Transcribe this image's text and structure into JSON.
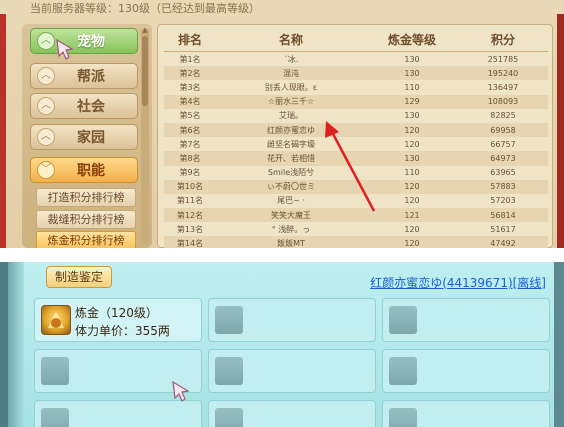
{
  "ranking": {
    "server_info": "当前服务器等级：130级（已经达到最高等级）",
    "nav": [
      {
        "label": "宠物",
        "state": "active",
        "chevron": "up"
      },
      {
        "label": "帮派",
        "state": "normal",
        "chevron": "up"
      },
      {
        "label": "社会",
        "state": "normal",
        "chevron": "up"
      },
      {
        "label": "家园",
        "state": "normal",
        "chevron": "up"
      },
      {
        "label": "职能",
        "state": "open",
        "chevron": "down"
      }
    ],
    "sub_nav": [
      {
        "label": "打造积分排行榜",
        "selected": false
      },
      {
        "label": "裁缝积分排行榜",
        "selected": false
      },
      {
        "label": "炼金积分排行榜",
        "selected": true
      }
    ],
    "columns": [
      "排名",
      "名称",
      "炼金等级",
      "积分"
    ],
    "rows": [
      [
        "第1名",
        "ˊ冰.",
        "130",
        "251785"
      ],
      [
        "第2名",
        "混沌",
        "130",
        "195240"
      ],
      [
        "第3名",
        "别丢人现眼。ε",
        "110",
        "136497"
      ],
      [
        "第4名",
        "☆丽水三千☆",
        "129",
        "108093"
      ],
      [
        "第5名",
        "艾瑞。",
        "130",
        "82825"
      ],
      [
        "第6名",
        "红颜亦蜜恋ゆ",
        "120",
        "69958"
      ],
      [
        "第7名",
        "雌坚名碣字壕",
        "120",
        "66757"
      ],
      [
        "第8名",
        "花开、若相惜",
        "130",
        "64973"
      ],
      [
        "第9名",
        "Smile浅陌兮",
        "110",
        "63965"
      ],
      [
        "第10名",
        "ぃ不蔚〇世ミ",
        "120",
        "57883"
      ],
      [
        "第11名",
        "尾巴~ ·",
        "120",
        "57203"
      ],
      [
        "第12名",
        "笑笑大魔王",
        "121",
        "56814"
      ],
      [
        "第13名",
        "° 浅醉。っ",
        "120",
        "51617"
      ],
      [
        "第14名",
        "飯飯MT",
        "120",
        "47492"
      ]
    ],
    "colors": {
      "arrow": "#e02020",
      "active_nav": "#86c45a",
      "open_nav": "#f2b14c"
    }
  },
  "appraisal": {
    "tab_label": "制造鉴定",
    "seller_link": "红颜亦蜜恋ゆ(44139671)[离线]",
    "item": {
      "name": "炼金（120级）",
      "price": "体力单价：355两",
      "icon": "alchemy-gold-icon"
    },
    "empty_slot_count": 8
  }
}
